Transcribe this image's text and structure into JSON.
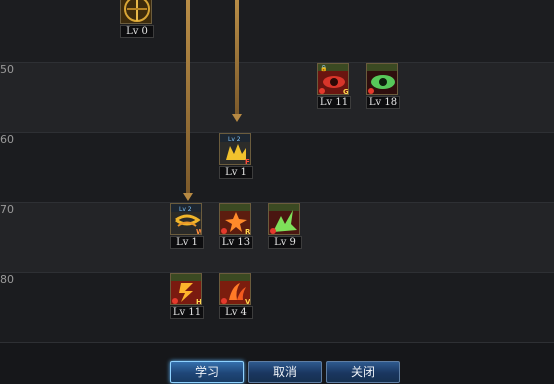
{
  "level_markers": [
    "50",
    "60",
    "70",
    "80"
  ],
  "skills": [
    {
      "id": "top-skill",
      "level_label": "Lv 0"
    },
    {
      "id": "red-eye-skill",
      "level_label": "Lv 11"
    },
    {
      "id": "green-eye-skill",
      "level_label": "Lv 18"
    },
    {
      "id": "yellow-burst-skill",
      "level_label": "Lv 1"
    },
    {
      "id": "gold-swirl-skill",
      "level_label": "Lv 1"
    },
    {
      "id": "fire-blast-skill",
      "level_label": "Lv 13"
    },
    {
      "id": "green-slash-skill",
      "level_label": "Lv 9"
    },
    {
      "id": "red-bolt-skill",
      "level_label": "Lv 11"
    },
    {
      "id": "red-claw-skill",
      "level_label": "Lv 4"
    }
  ],
  "buttons": {
    "learn": "学习",
    "cancel": "取消",
    "close": "关闭"
  }
}
